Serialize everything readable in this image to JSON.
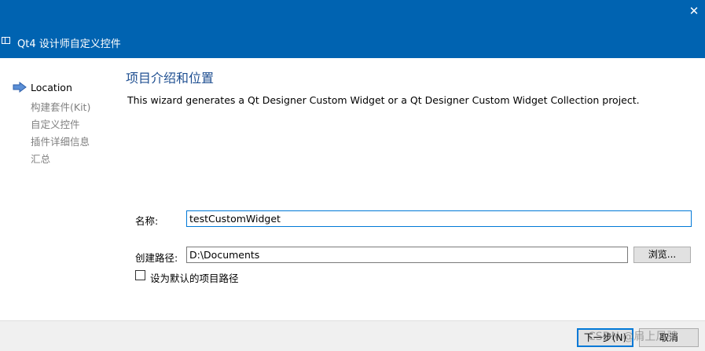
{
  "window": {
    "title": "Qt4 设计师自定义控件",
    "close_glyph": "✕",
    "title_bar_color": "#0063b1"
  },
  "steps": [
    {
      "label": "Location",
      "active": true
    },
    {
      "label": "构建套件(Kit)",
      "active": false
    },
    {
      "label": "自定义控件",
      "active": false
    },
    {
      "label": "插件详细信息",
      "active": false
    },
    {
      "label": "汇总",
      "active": false
    }
  ],
  "page": {
    "title": "项目介绍和位置",
    "description": "This wizard generates a Qt Designer Custom Widget or a Qt Designer Custom Widget Collection project."
  },
  "form": {
    "name_label": "名称:",
    "name_value": "testCustomWidget",
    "path_label": "创建路径:",
    "path_value": "D:\\Documents",
    "browse_label": "浏览...",
    "default_path_label": "设为默认的项目路径",
    "default_path_checked": false
  },
  "footer": {
    "next_label": "下一步(N)",
    "cancel_label": "取消",
    "watermark": "CSDN @肩上风骋"
  }
}
